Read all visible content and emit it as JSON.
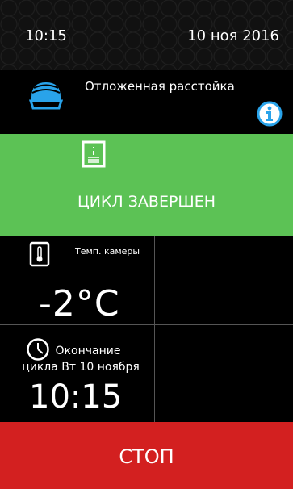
{
  "status_bar": {
    "time": "10:15",
    "date": "10 ноя 2016"
  },
  "program": {
    "title": "Отложенная расстойка",
    "icon": "proofing-dome-icon",
    "info_icon": "info-icon"
  },
  "cycle_status": {
    "label": "ЦИКЛ ЗАВЕРШЕН",
    "icon": "recipe-document-icon",
    "color": "#5cc255"
  },
  "chamber_temp": {
    "label": "Темп. камеры",
    "value": "-2°C",
    "icon": "thermometer-icon"
  },
  "cycle_end": {
    "label_line1": "Окончание",
    "label_line2": "цикла Вт 10 ноября",
    "time": "10:15",
    "icon": "clock-icon"
  },
  "stop_button": {
    "label": "СТОП",
    "color": "#d32020"
  },
  "colors": {
    "accent_blue": "#29a3ea",
    "background": "#000000"
  }
}
